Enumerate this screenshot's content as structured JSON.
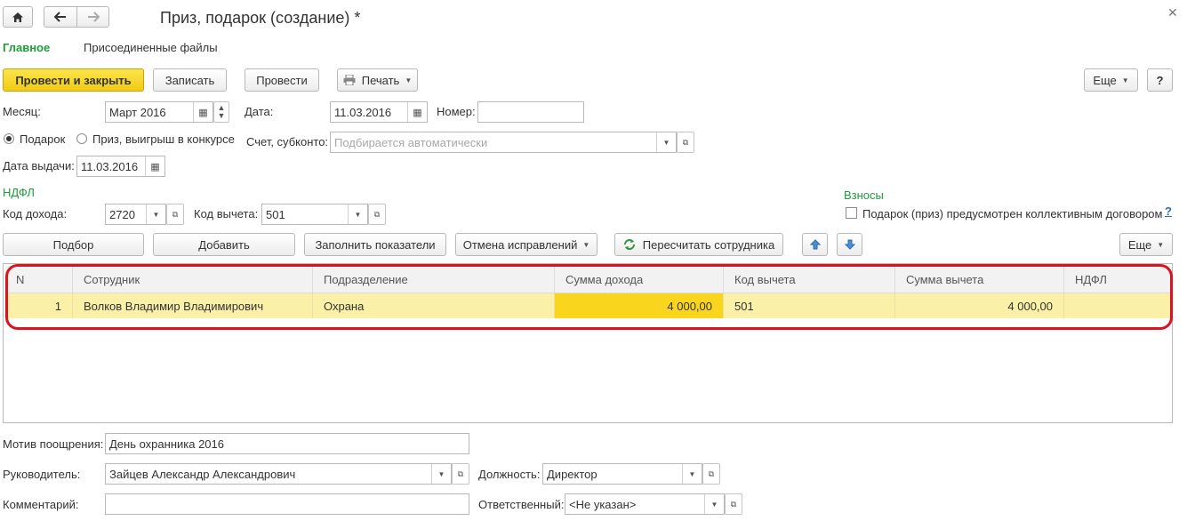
{
  "window": {
    "title": "Приз, подарок (создание) *",
    "close_icon": "close-icon"
  },
  "tabs": [
    {
      "label": "Главное",
      "active": true
    },
    {
      "label": "Присоединенные файлы",
      "active": false
    }
  ],
  "toolbar": {
    "post_close": "Провести и закрыть",
    "save": "Записать",
    "post": "Провести",
    "print": "Печать",
    "more": "Еще",
    "help": "?"
  },
  "form": {
    "month_label": "Месяц:",
    "month_value": "Март 2016",
    "date_label": "Дата:",
    "date_value": "11.03.2016",
    "number_label": "Номер:",
    "number_value": "",
    "radio_gift": "Подарок",
    "radio_prize": "Приз, выигрыш в конкурсе",
    "account_label": "Счет, субконто:",
    "account_placeholder": "Подбирается автоматически",
    "issue_date_label": "Дата выдачи:",
    "issue_date_value": "11.03.2016",
    "ndfl_section": "НДФЛ",
    "income_code_label": "Код дохода:",
    "income_code_value": "2720",
    "deduction_code_label": "Код вычета:",
    "deduction_code_value": "501",
    "contrib_section": "Взносы",
    "collective_checkbox": "Подарок (приз) предусмотрен коллективным договором",
    "collective_help": "?"
  },
  "table_toolbar": {
    "select": "Подбор",
    "add": "Добавить",
    "fill": "Заполнить показатели",
    "cancel_fix": "Отмена исправлений",
    "recalc": "Пересчитать сотрудника",
    "more": "Еще"
  },
  "table": {
    "columns": [
      "N",
      "Сотрудник",
      "Подразделение",
      "Сумма дохода",
      "Код вычета",
      "Сумма вычета",
      "НДФЛ"
    ],
    "rows": [
      [
        "1",
        "Волков Владимир Владимирович",
        "Охрана",
        "4 000,00",
        "501",
        "4 000,00",
        ""
      ]
    ]
  },
  "footer": {
    "motive_label": "Мотив поощрения:",
    "motive_value": "День охранника 2016",
    "head_label": "Руководитель:",
    "head_value": "Зайцев Александр Александрович",
    "position_label": "Должность:",
    "position_value": "Директор",
    "comment_label": "Комментарий:",
    "comment_value": "",
    "responsible_label": "Ответственный:",
    "responsible_value": "<Не указан>"
  },
  "colors": {
    "accent_green": "#1e9c3a",
    "primary_yellow": "#f5d42a",
    "row_highlight": "#fbf0a7",
    "cell_highlight": "#f9d61d",
    "annotation_red": "#d8151f"
  }
}
